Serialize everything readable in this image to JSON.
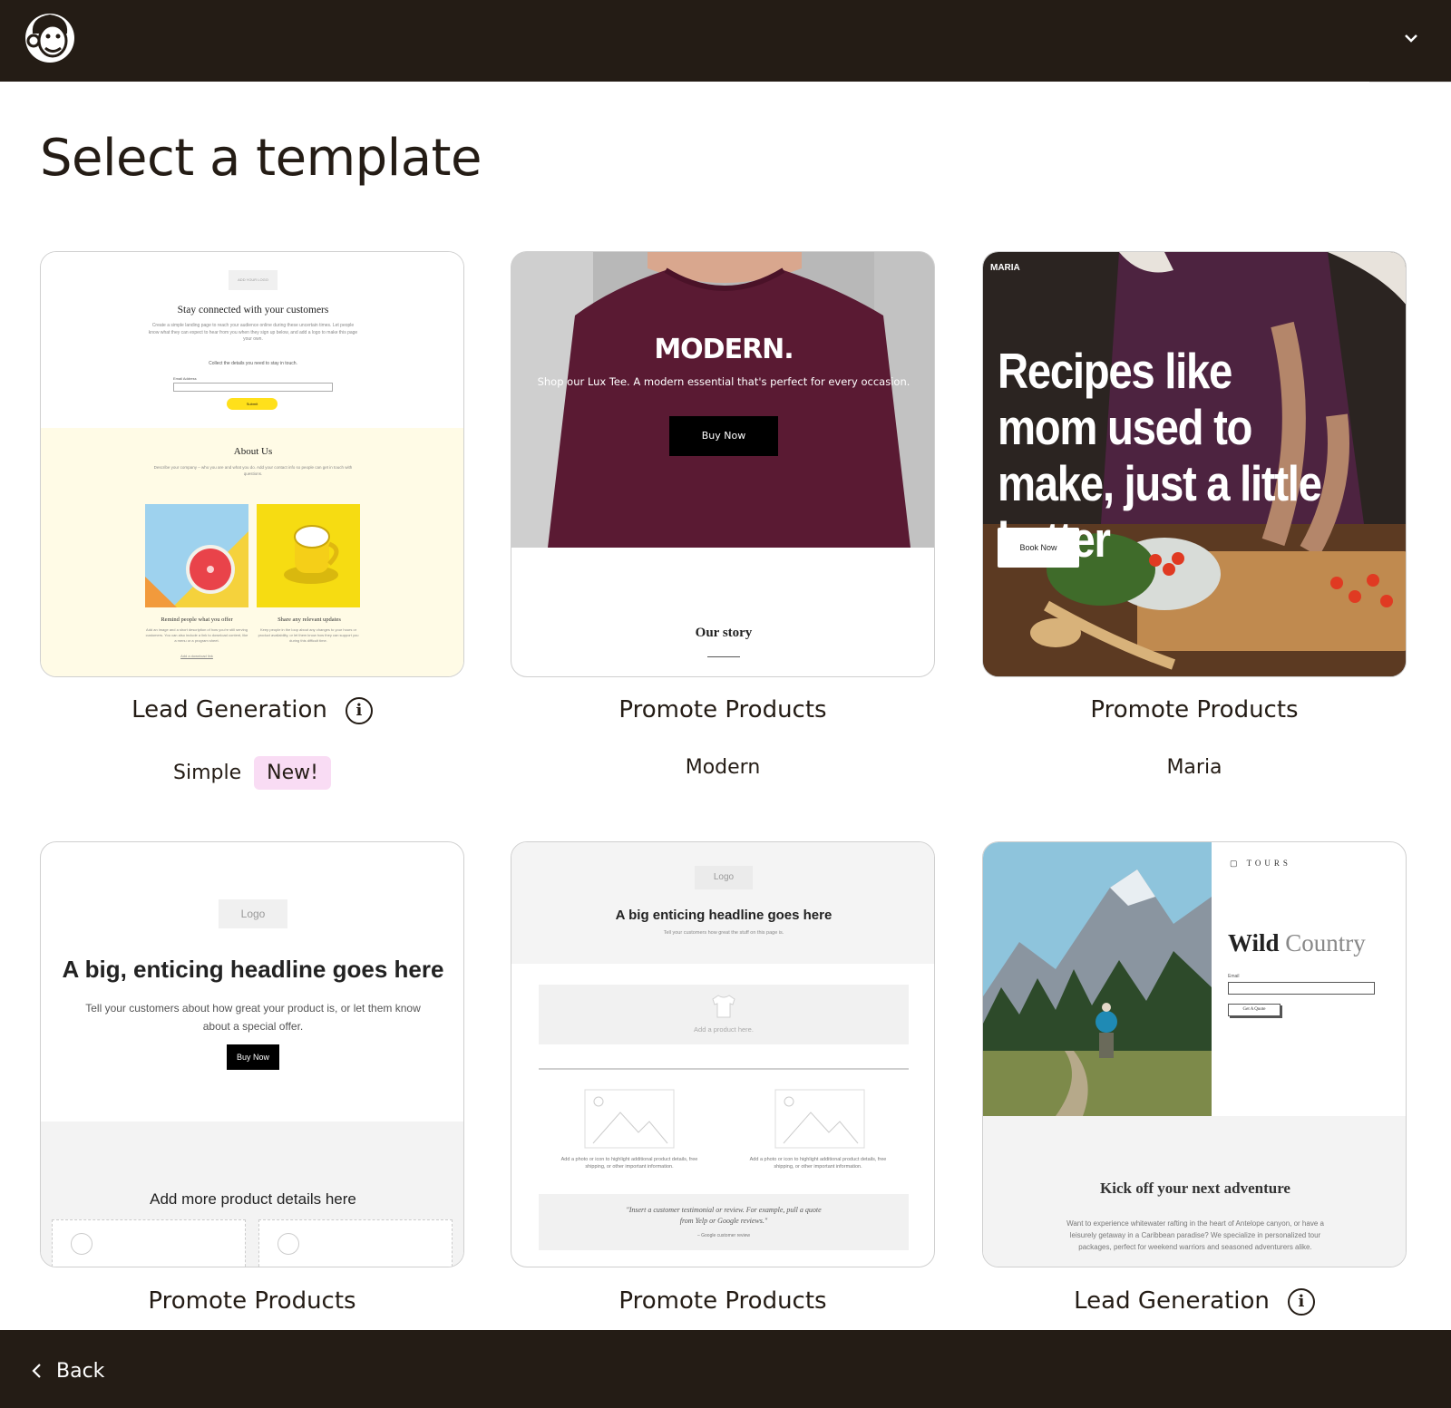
{
  "header": {
    "logo_icon": "freddie-logo-icon",
    "menu_icon": "chevron-down-icon"
  },
  "page": {
    "title": "Select a template"
  },
  "templates": [
    {
      "category": "Lead Generation",
      "name": "Simple",
      "badge": "New!",
      "preview": {
        "logo": "ADD YOUR LOGO",
        "heading": "Stay connected with your customers",
        "body": "Create a simple landing page to reach your audience online during these uncertain times. Let people know what they can expect to hear from you when they sign up below, and add a logo to make this page your own.",
        "collect": "Collect the details you need to stay in touch.",
        "email_label": "Email Address",
        "submit": "Submit",
        "about_heading": "About Us",
        "about_body": "Describe your company – who you are and what you do. Add your contact info so people can get in touch with questions.",
        "col1_title": "Remind people what you offer",
        "col1_body": "Add an image and a short description of how you're still serving customers. You can also include a link to download content, like a menu or a program sheet.",
        "col1_link": "Add a download link",
        "col2_title": "Share any relevant updates",
        "col2_body": "Keep people in the loop about any changes to your hours or product availability, or let them know how they can support you during this difficult time."
      }
    },
    {
      "category": "Promote Products",
      "name": "Modern",
      "preview": {
        "headline": "MODERN.",
        "sub": "Shop our Lux Tee. A modern essential that's perfect for every occasion.",
        "button": "Buy Now",
        "story": "Our story"
      }
    },
    {
      "category": "Promote Products",
      "name": "Maria",
      "preview": {
        "brand": "MARIA",
        "headline": "Recipes like mom used to make, just a little better",
        "button": "Book Now"
      }
    },
    {
      "category": "Promote Products",
      "preview": {
        "logo": "Logo",
        "headline": "A big, enticing headline goes here",
        "sub": "Tell your customers about how great your product is, or let them know about a special offer.",
        "button": "Buy Now",
        "details": "Add more product details here"
      }
    },
    {
      "category": "Promote Products",
      "preview": {
        "logo": "Logo",
        "headline": "A big enticing headline goes here",
        "sub": "Tell your customers how great the stuff on this page is.",
        "product": "Add a product here.",
        "col_text": "Add a photo or icon to highlight additional product details, free shipping, or other important information.",
        "quote": "\"Insert a customer testimonial or review. For example, pull a quote from Yelp or Google reviews.\"",
        "quote_source": "– Google customer review"
      }
    },
    {
      "category": "Lead Generation",
      "preview": {
        "brand": "TOURS",
        "title_bold": "Wild",
        "title_light": "Country",
        "email_label": "Email",
        "button": "Get A Quote",
        "heading": "Kick off your next adventure",
        "body": "Want to experience whitewater rafting in the heart of Antelope canyon, or have a leisurely getaway in a Caribbean paradise? We specialize in personalized tour packages, perfect for weekend warriors and seasoned adventurers alike."
      }
    }
  ],
  "footer": {
    "back_label": "Back",
    "back_icon": "chevron-left-icon"
  },
  "colors": {
    "brand_dark": "#241c15",
    "badge_pink": "#f9dcf4",
    "cream": "#fffbe6",
    "yellow": "#ffe01b",
    "maroon": "#5a1a33"
  }
}
